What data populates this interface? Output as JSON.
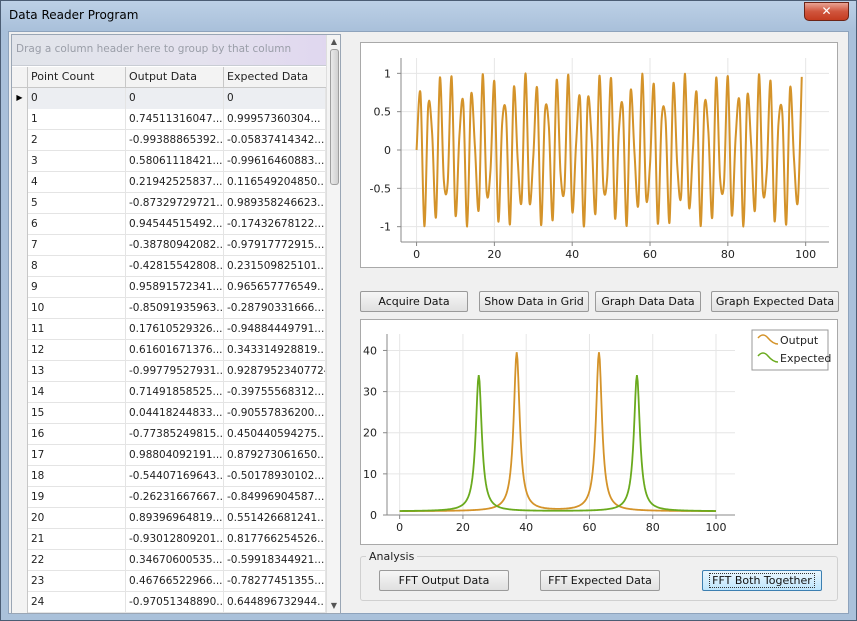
{
  "window": {
    "title": "Data Reader Program",
    "close_glyph": "✕"
  },
  "grid": {
    "group_panel_hint": "Drag a column header here to group by that column",
    "columns": [
      "Point Count",
      "Output Data",
      "Expected Data"
    ],
    "current_row_glyph": "▶",
    "rows": [
      [
        "0",
        "0",
        "0"
      ],
      [
        "1",
        "0.74511316047...",
        "0.99957360304..."
      ],
      [
        "2",
        "-0.99388865392...",
        "-0.05837414342..."
      ],
      [
        "3",
        "0.58061118421...",
        "-0.99616460883..."
      ],
      [
        "4",
        "0.21942525837...",
        "0.116549204850..."
      ],
      [
        "5",
        "-0.87329729721...",
        "0.989358246623..."
      ],
      [
        "6",
        "0.94544515492...",
        "-0.17432678122..."
      ],
      [
        "7",
        "-0.38780942082...",
        "-0.97917772915..."
      ],
      [
        "8",
        "-0.42815542808...",
        "0.231509825101..."
      ],
      [
        "9",
        "0.95891572341...",
        "0.965657776549..."
      ],
      [
        "10",
        "-0.85091935963...",
        "-0.28790331666..."
      ],
      [
        "11",
        "0.17610529326...",
        "-0.94884449791..."
      ],
      [
        "12",
        "0.61601671376...",
        "0.343314928819..."
      ],
      [
        "13",
        "-0.99779527931...",
        "0.92879523407724"
      ],
      [
        "14",
        "0.71491858525...",
        "-0.39755568312..."
      ],
      [
        "15",
        "0.04418244833...",
        "-0.90557836200..."
      ],
      [
        "16",
        "-0.77385249815...",
        "0.450440594275..."
      ],
      [
        "17",
        "0.98804092191...",
        "0.879273061650..."
      ],
      [
        "18",
        "-0.54407169643...",
        "-0.50178930102..."
      ],
      [
        "19",
        "-0.26231667667...",
        "-0.84996904587..."
      ],
      [
        "20",
        "0.89396964819...",
        "0.551426681241..."
      ],
      [
        "21",
        "-0.93012809201...",
        "0.817766254526..."
      ],
      [
        "22",
        "0.34670600535...",
        "-0.59918344921..."
      ],
      [
        "23",
        "0.46766522966...",
        "-0.78277451355..."
      ],
      [
        "24",
        "-0.97051348890...",
        "0.644896732944..."
      ]
    ]
  },
  "buttons": {
    "acquire": "Acquire Data",
    "show_grid": "Show Data in Grid",
    "graph_data": "Graph Data Data",
    "graph_expected": "Graph Expected Data",
    "fft_output": "FFT Output Data",
    "fft_expected": "FFT Expected Data",
    "fft_both": "FFT Both Together"
  },
  "analysis_label": "Analysis",
  "chart_data": [
    {
      "type": "line",
      "title": "",
      "xlabel": "",
      "ylabel": "",
      "xlim": [
        -4,
        106
      ],
      "ylim": [
        -1.2,
        1.2
      ],
      "x_ticks": [
        0,
        20,
        40,
        60,
        80,
        100
      ],
      "y_ticks": [
        1,
        0.5,
        0,
        -0.5,
        -1
      ],
      "y_tick_labels": [
        "1",
        "0.5",
        "0",
        "-0.5",
        "-1"
      ],
      "grid": true,
      "legend": "none",
      "color": "#d4932a",
      "series": [
        {
          "x": [
            0,
            1,
            2,
            3,
            4,
            5,
            6,
            7,
            8,
            9,
            10,
            11,
            12,
            13,
            14,
            15,
            16,
            17,
            18,
            19,
            20,
            21,
            22,
            23,
            24,
            25,
            26,
            27,
            28,
            29,
            30,
            31,
            32,
            33,
            34,
            35,
            36,
            37,
            38,
            39,
            40,
            41,
            42,
            43,
            44,
            45,
            46,
            47,
            48,
            49,
            50,
            51,
            52,
            53,
            54,
            55,
            56,
            57,
            58,
            59,
            60,
            61,
            62,
            63,
            64,
            65,
            66,
            67,
            68,
            69,
            70,
            71,
            72,
            73,
            74,
            75,
            76,
            77,
            78,
            79,
            80,
            81,
            82,
            83,
            84,
            85,
            86,
            87,
            88,
            89,
            90,
            91,
            92,
            93,
            94,
            95,
            96,
            97,
            98,
            99
          ],
          "values": [
            0,
            0.745,
            -0.994,
            0.581,
            0.219,
            -0.873,
            0.945,
            -0.388,
            -0.428,
            0.959,
            -0.851,
            0.176,
            0.616,
            -0.998,
            0.715,
            0.044,
            -0.774,
            0.988,
            -0.544,
            -0.262,
            0.894,
            -0.93,
            0.347,
            0.468,
            -0.971,
            0.817,
            -0.132,
            -0.663,
            0.999,
            -0.672,
            -0.089,
            0.805,
            -0.979,
            0.498,
            0.308,
            -0.912,
            0.911,
            -0.298,
            -0.508,
            0.982,
            -0.798,
            0.079,
            0.679,
            -0.999,
            0.656,
            0.143,
            -0.824,
            0.968,
            -0.458,
            -0.354,
            0.936,
            -0.889,
            0.25,
            0.553,
            -0.991,
            0.767,
            -0.03,
            -0.712,
            0.996,
            -0.625,
            -0.189,
            0.854,
            -0.96,
            0.41,
            0.393,
            -0.95,
            0.866,
            -0.201,
            -0.596,
            0.994,
            -0.735,
            -0.019,
            0.742,
            -0.993,
            0.588,
            0.238,
            -0.88,
            0.942,
            -0.365,
            -0.439,
            0.962,
            -0.844,
            0.16,
            0.627,
            -0.998,
            0.703,
            0.064,
            -0.778,
            0.987,
            -0.538,
            -0.277,
            0.898,
            -0.927,
            0.333,
            0.478,
            -0.973,
            0.811,
            -0.115,
            -0.67,
            0.954
          ]
        }
      ]
    },
    {
      "type": "line",
      "title": "",
      "xlabel": "",
      "ylabel": "",
      "xlim": [
        -4,
        106
      ],
      "ylim": [
        0,
        44
      ],
      "x_ticks": [
        0,
        20,
        40,
        60,
        80,
        100
      ],
      "y_ticks": [
        0,
        10,
        20,
        30,
        40
      ],
      "grid": true,
      "legend": "top-right",
      "series": [
        {
          "name": "Output",
          "color": "#d4932a",
          "peaks": [
            {
              "x": 37,
              "y": 39.5
            },
            {
              "x": 63,
              "y": 39.5
            }
          ],
          "x_start": 0,
          "x_end": 100
        },
        {
          "name": "Expected",
          "color": "#6aaa1e",
          "peaks": [
            {
              "x": 25,
              "y": 34
            },
            {
              "x": 75,
              "y": 34
            }
          ],
          "x_start": 0,
          "x_end": 100
        }
      ]
    }
  ]
}
